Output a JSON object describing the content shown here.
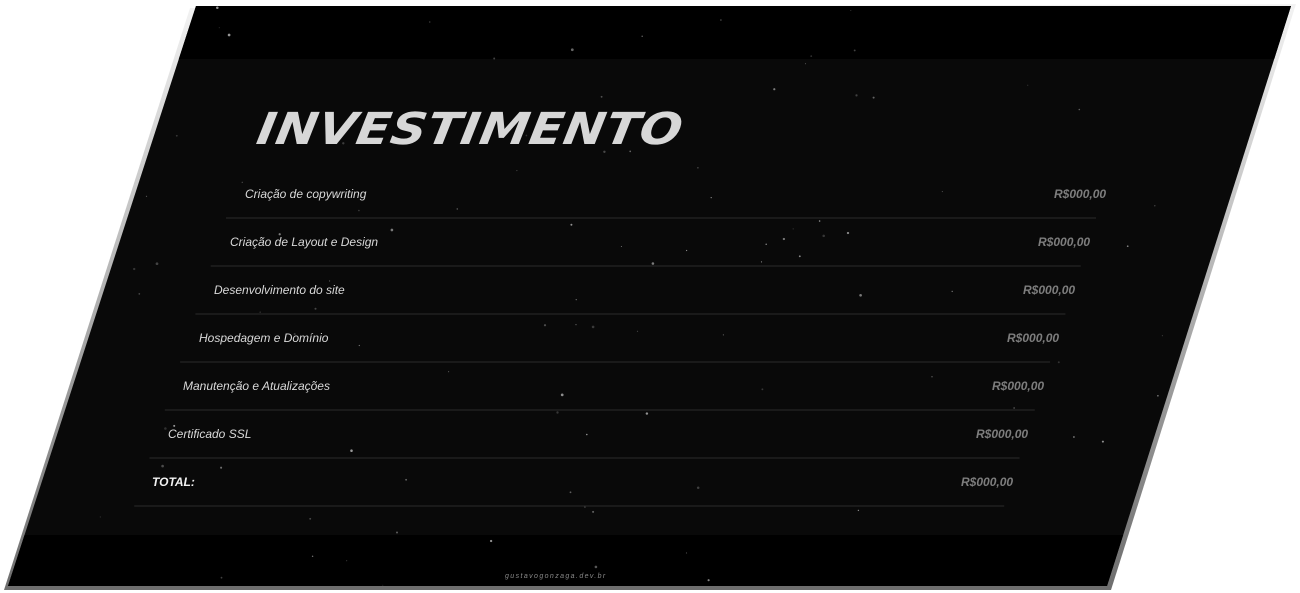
{
  "title": "INVESTIMENTO",
  "rows": [
    {
      "label": "Criação de copywriting",
      "price": "R$000,00"
    },
    {
      "label": "Criação de Layout e Design",
      "price": "R$000,00"
    },
    {
      "label": "Desenvolvimento do site",
      "price": "R$000,00"
    },
    {
      "label": "Hospedagem e Domínio",
      "price": "R$000,00"
    },
    {
      "label": "Manutenção e Atualizações",
      "price": "R$000,00"
    },
    {
      "label": "Certificado SSL",
      "price": "R$000,00"
    }
  ],
  "total": {
    "label": "TOTAL:",
    "price": "R$000,00"
  },
  "footer": "gustavogonzaga.dev.br",
  "colors": {
    "background": "#090909",
    "band": "#000000",
    "title": "#d7d7d7",
    "label": "#d9d9d9",
    "price": "#7d7d7d",
    "divider": "#2b2b2b",
    "frame_edge": "#7a7a7a"
  }
}
